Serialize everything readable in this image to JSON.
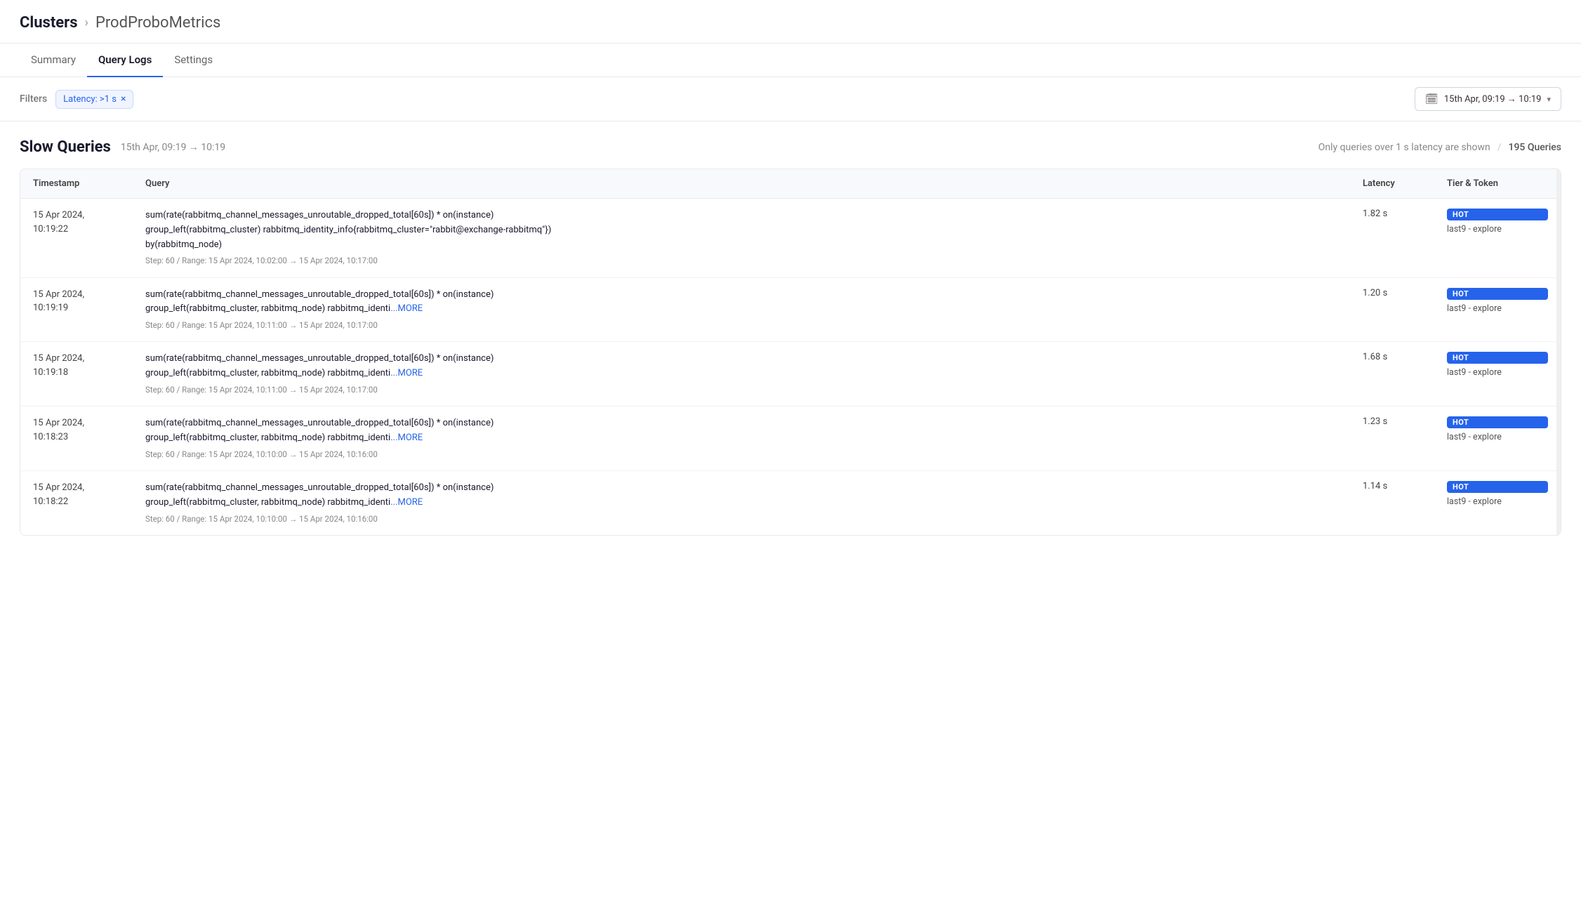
{
  "breadcrumb": {
    "clusters_label": "Clusters",
    "chevron": "›",
    "current": "ProdProboMetrics"
  },
  "tabs": [
    {
      "id": "summary",
      "label": "Summary",
      "active": false
    },
    {
      "id": "query-logs",
      "label": "Query Logs",
      "active": true
    },
    {
      "id": "settings",
      "label": "Settings",
      "active": false
    }
  ],
  "filters": {
    "label": "Filters",
    "chip_label": "Latency: >1 s",
    "chip_close": "×"
  },
  "date_range": {
    "icon": "📅",
    "label": "15th Apr, 09:19 → 10:19",
    "chevron": "▾"
  },
  "slow_queries": {
    "title": "Slow Queries",
    "date_range": "15th Apr, 09:19 → 10:19",
    "meta_note": "Only queries over 1 s latency are shown",
    "divider": "/",
    "query_count": "195 Queries",
    "table": {
      "headers": {
        "timestamp": "Timestamp",
        "query": "Query",
        "latency": "Latency",
        "tier_token": "Tier & Token"
      },
      "rows": [
        {
          "timestamp": "15 Apr 2024,\n10:19:22",
          "query_line1": "sum(rate(rabbitmq_channel_messages_unroutable_dropped_total[60s]) * on(instance)",
          "query_line2": "group_left(rabbitmq_cluster) rabbitmq_identity_info{rabbitmq_cluster=\"rabbit@exchange-rabbitmq\"})",
          "query_line3": "by(rabbitmq_node)",
          "query_meta": "Step: 60 / Range: 15 Apr 2024, 10:02:00 → 15 Apr 2024, 10:17:00",
          "has_more": false,
          "latency": "1.82 s",
          "tier": "HOT",
          "token": "last9 - explore"
        },
        {
          "timestamp": "15 Apr 2024,\n10:19:19",
          "query_line1": "sum(rate(rabbitmq_channel_messages_unroutable_dropped_total[60s]) * on(instance)",
          "query_line2": "group_left(rabbitmq_cluster, rabbitmq_node) rabbitmq_identi",
          "query_line3": "",
          "query_meta": "Step: 60 / Range: 15 Apr 2024, 10:11:00 → 15 Apr 2024, 10:17:00",
          "has_more": true,
          "more_label": "...MORE",
          "latency": "1.20 s",
          "tier": "HOT",
          "token": "last9 - explore"
        },
        {
          "timestamp": "15 Apr 2024,\n10:19:18",
          "query_line1": "sum(rate(rabbitmq_channel_messages_unroutable_dropped_total[60s]) * on(instance)",
          "query_line2": "group_left(rabbitmq_cluster, rabbitmq_node) rabbitmq_identi",
          "query_line3": "",
          "query_meta": "Step: 60 / Range: 15 Apr 2024, 10:11:00 → 15 Apr 2024, 10:17:00",
          "has_more": true,
          "more_label": "...MORE",
          "latency": "1.68 s",
          "tier": "HOT",
          "token": "last9 - explore"
        },
        {
          "timestamp": "15 Apr 2024,\n10:18:23",
          "query_line1": "sum(rate(rabbitmq_channel_messages_unroutable_dropped_total[60s]) * on(instance)",
          "query_line2": "group_left(rabbitmq_cluster, rabbitmq_node) rabbitmq_identi",
          "query_line3": "",
          "query_meta": "Step: 60 / Range: 15 Apr 2024, 10:10:00 → 15 Apr 2024, 10:16:00",
          "has_more": true,
          "more_label": "...MORE",
          "latency": "1.23 s",
          "tier": "HOT",
          "token": "last9 - explore"
        },
        {
          "timestamp": "15 Apr 2024,\n10:18:22",
          "query_line1": "sum(rate(rabbitmq_channel_messages_unroutable_dropped_total[60s]) * on(instance)",
          "query_line2": "group_left(rabbitmq_cluster, rabbitmq_node) rabbitmq_identi",
          "query_line3": "",
          "query_meta": "Step: 60 / Range: 15 Apr 2024, 10:10:00 → 15 Apr 2024, 10:16:00",
          "has_more": true,
          "more_label": "...MORE",
          "latency": "1.14 s",
          "tier": "HOT",
          "token": "last9 - explore"
        }
      ]
    }
  }
}
